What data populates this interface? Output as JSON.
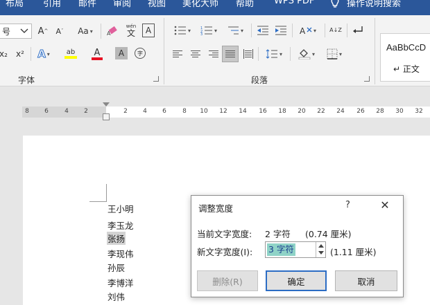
{
  "menu": {
    "items": [
      "布局",
      "引用",
      "邮件",
      "审阅",
      "视图",
      "美化大师",
      "帮助",
      "WPS PDF"
    ],
    "search": "操作说明搜索"
  },
  "ribbon": {
    "font_group": {
      "label": "字体",
      "font_size_label": "号",
      "grow": "A",
      "shrink": "A",
      "change_case": "Aa",
      "pinyin_top": "wén",
      "pinyin_char": "文",
      "border_char": "A",
      "subscript": "x₂",
      "superscript": "x²",
      "text_effect": "A",
      "highlight": "ab",
      "font_color": "A",
      "char_shading": "A",
      "enclose": "字"
    },
    "paragraph_group": {
      "label": "段落",
      "sort": "A↓Z"
    },
    "styles": {
      "preview": "AaBbCcD",
      "name": "↵ 正文"
    }
  },
  "ruler": {
    "left_numbers": [
      "8",
      "6",
      "4",
      "2"
    ],
    "right_numbers": [
      "2",
      "4",
      "6",
      "8",
      "10",
      "12",
      "14",
      "16",
      "18",
      "20",
      "22",
      "24",
      "26",
      "28",
      "30",
      "32"
    ]
  },
  "document": {
    "names": [
      "王小明",
      "李玉龙",
      "张扬",
      "李现伟",
      "孙辰",
      "李博洋",
      "刘伟"
    ],
    "selected_index": 2
  },
  "dialog": {
    "title": "调整宽度",
    "help": "?",
    "close": "✕",
    "current_label": "当前文字宽度:",
    "current_value": "2 字符",
    "current_cm": "(0.74 厘米)",
    "new_label": "新文字宽度(I):",
    "new_value": "3 字符",
    "new_cm": "(1.11 厘米)",
    "delete_button": "删除(R)",
    "ok_button": "确定",
    "cancel_button": "取消"
  },
  "colors": {
    "menubar": "#2b579a",
    "highlight_yellow": "#ffff00",
    "font_red": "#e81123",
    "selection": "#8fd3c7"
  }
}
